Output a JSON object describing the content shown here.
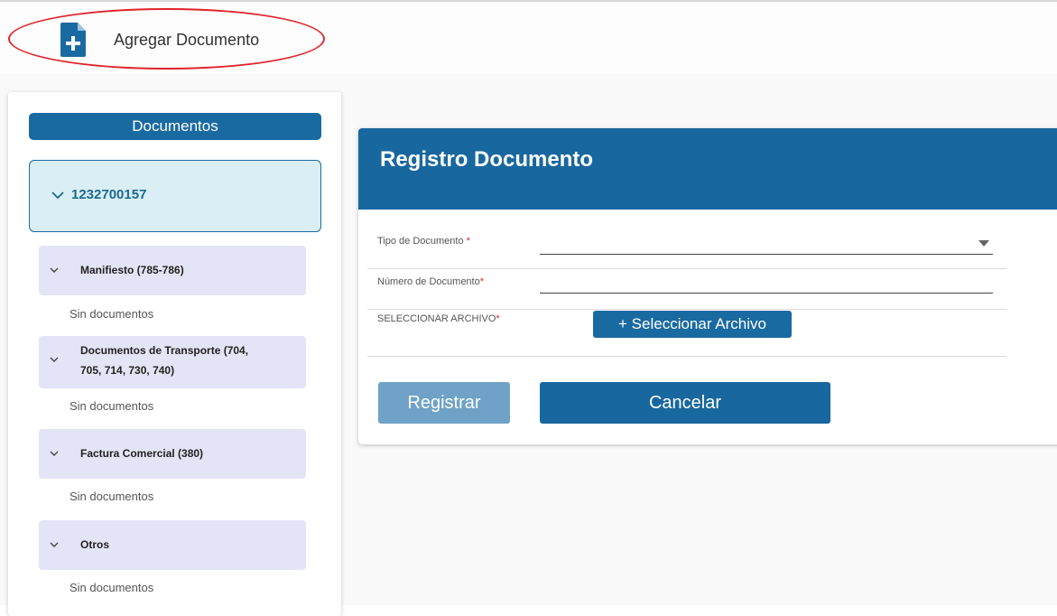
{
  "header": {
    "title": "Agregar Documento",
    "icon": "add-document-icon",
    "highlight_color": "#e0242b"
  },
  "sidebar": {
    "title": "Documentos",
    "root": {
      "label": "1232700157",
      "expanded": true
    },
    "categories": [
      {
        "label_lines": [
          "Manifiesto (785-786)"
        ],
        "empty_text": "Sin documentos"
      },
      {
        "label_lines": [
          "Documentos de Transporte (704,",
          "705, 714, 730, 740)"
        ],
        "empty_text": "Sin documentos"
      },
      {
        "label_lines": [
          "Factura Comercial (380)"
        ],
        "empty_text": "Sin documentos"
      },
      {
        "label_lines": [
          "Otros"
        ],
        "empty_text": "Sin documentos"
      }
    ]
  },
  "form": {
    "title": "Registro Documento",
    "fields": {
      "tipo": {
        "label": "Tipo de Documento",
        "required_mark": "*",
        "value": ""
      },
      "numero": {
        "label": "Número de Documento",
        "required_mark": "*",
        "value": ""
      },
      "archivo": {
        "label": "SELECCIONAR ARCHIVO",
        "required_mark": "*"
      }
    },
    "select_file_label": "+ Seleccionar Archivo",
    "register_label": "Registrar",
    "cancel_label": "Cancelar"
  },
  "colors": {
    "primary": "#18679f",
    "primary_light": "#6fa2c6",
    "root_bg": "#d9eef5",
    "category_bg": "#e4e4f7",
    "required": "#e0242b"
  }
}
